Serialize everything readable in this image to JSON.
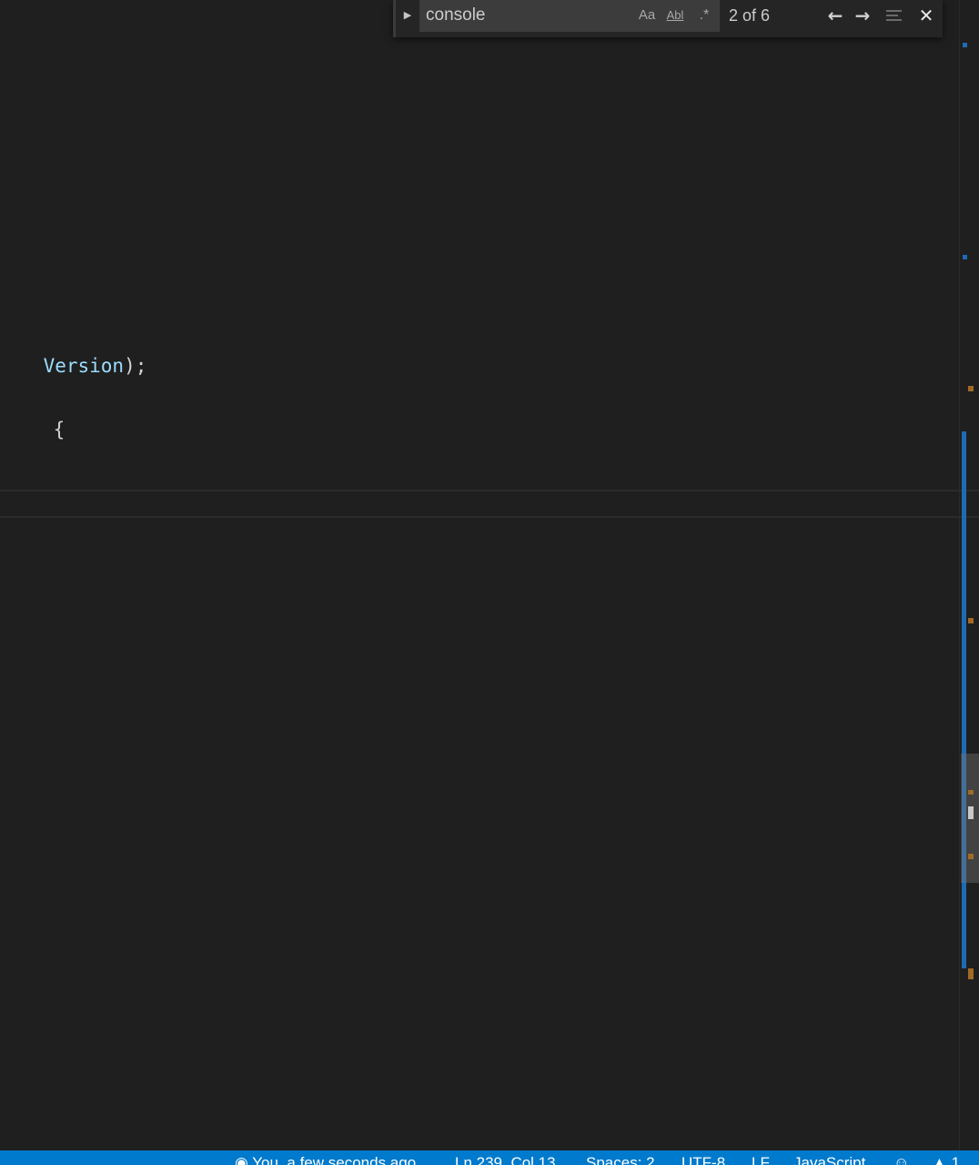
{
  "editor": {
    "lines": [
      {
        "var": "Version",
        "punc": ");"
      },
      {
        "text": "{"
      }
    ]
  },
  "find_widget": {
    "query": "console",
    "match_case_label": "Aa",
    "whole_word_label": "Abl",
    "regex_label": ".*",
    "match_count": "2 of 6",
    "toggle_replace_icon": "chevron-right-icon",
    "prev_icon": "arrow-left-icon",
    "next_icon": "arrow-right-icon",
    "selection_icon": "find-in-selection-icon",
    "close_icon": "close-icon"
  },
  "status_bar": {
    "blame": "You, a few seconds ago",
    "position": "Ln 239, Col 13",
    "indent": "Spaces: 2",
    "encoding": "UTF-8",
    "eol": "LF",
    "language": "JavaScript",
    "feedback_icon": "smiley-icon",
    "notifications_icon": "bell-icon",
    "notifications_count": "1"
  },
  "colors": {
    "editor_background": "#1f1f1f",
    "status_bar": "#007acc",
    "find_match_marker": "#1e6bb3",
    "modified_marker": "#a06b26"
  }
}
